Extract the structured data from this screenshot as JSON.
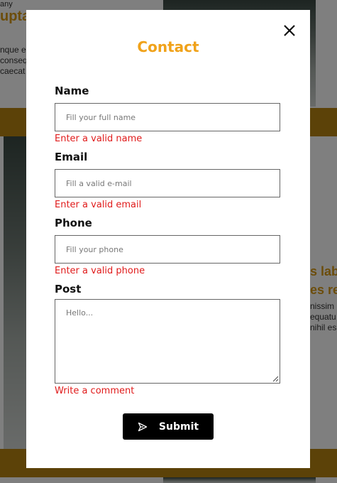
{
  "background": {
    "top_left_lines": [
      "any",
      "upta",
      "nque e",
      "conseq",
      "caecat"
    ],
    "right_lines": [
      "s lab",
      "es re",
      "nissim",
      "equatu",
      "nihil es"
    ]
  },
  "modal": {
    "title": "Contact",
    "close_icon": "close-icon",
    "fields": [
      {
        "label": "Name",
        "placeholder": "Fill your full name",
        "error": "Enter a valid name"
      },
      {
        "label": "Email",
        "placeholder": "Fill a valid e-mail",
        "error": "Enter a valid email"
      },
      {
        "label": "Phone",
        "placeholder": "Fill your phone",
        "error": "Enter a valid phone"
      },
      {
        "label": "Post",
        "placeholder": "Hello...",
        "error": "Write a comment"
      }
    ],
    "submit": {
      "label": "Submit",
      "icon": "send-icon"
    }
  },
  "colors": {
    "accent": "#f0a21a",
    "error": "#e01b1b",
    "button": "#000000",
    "band": "#b98510"
  }
}
